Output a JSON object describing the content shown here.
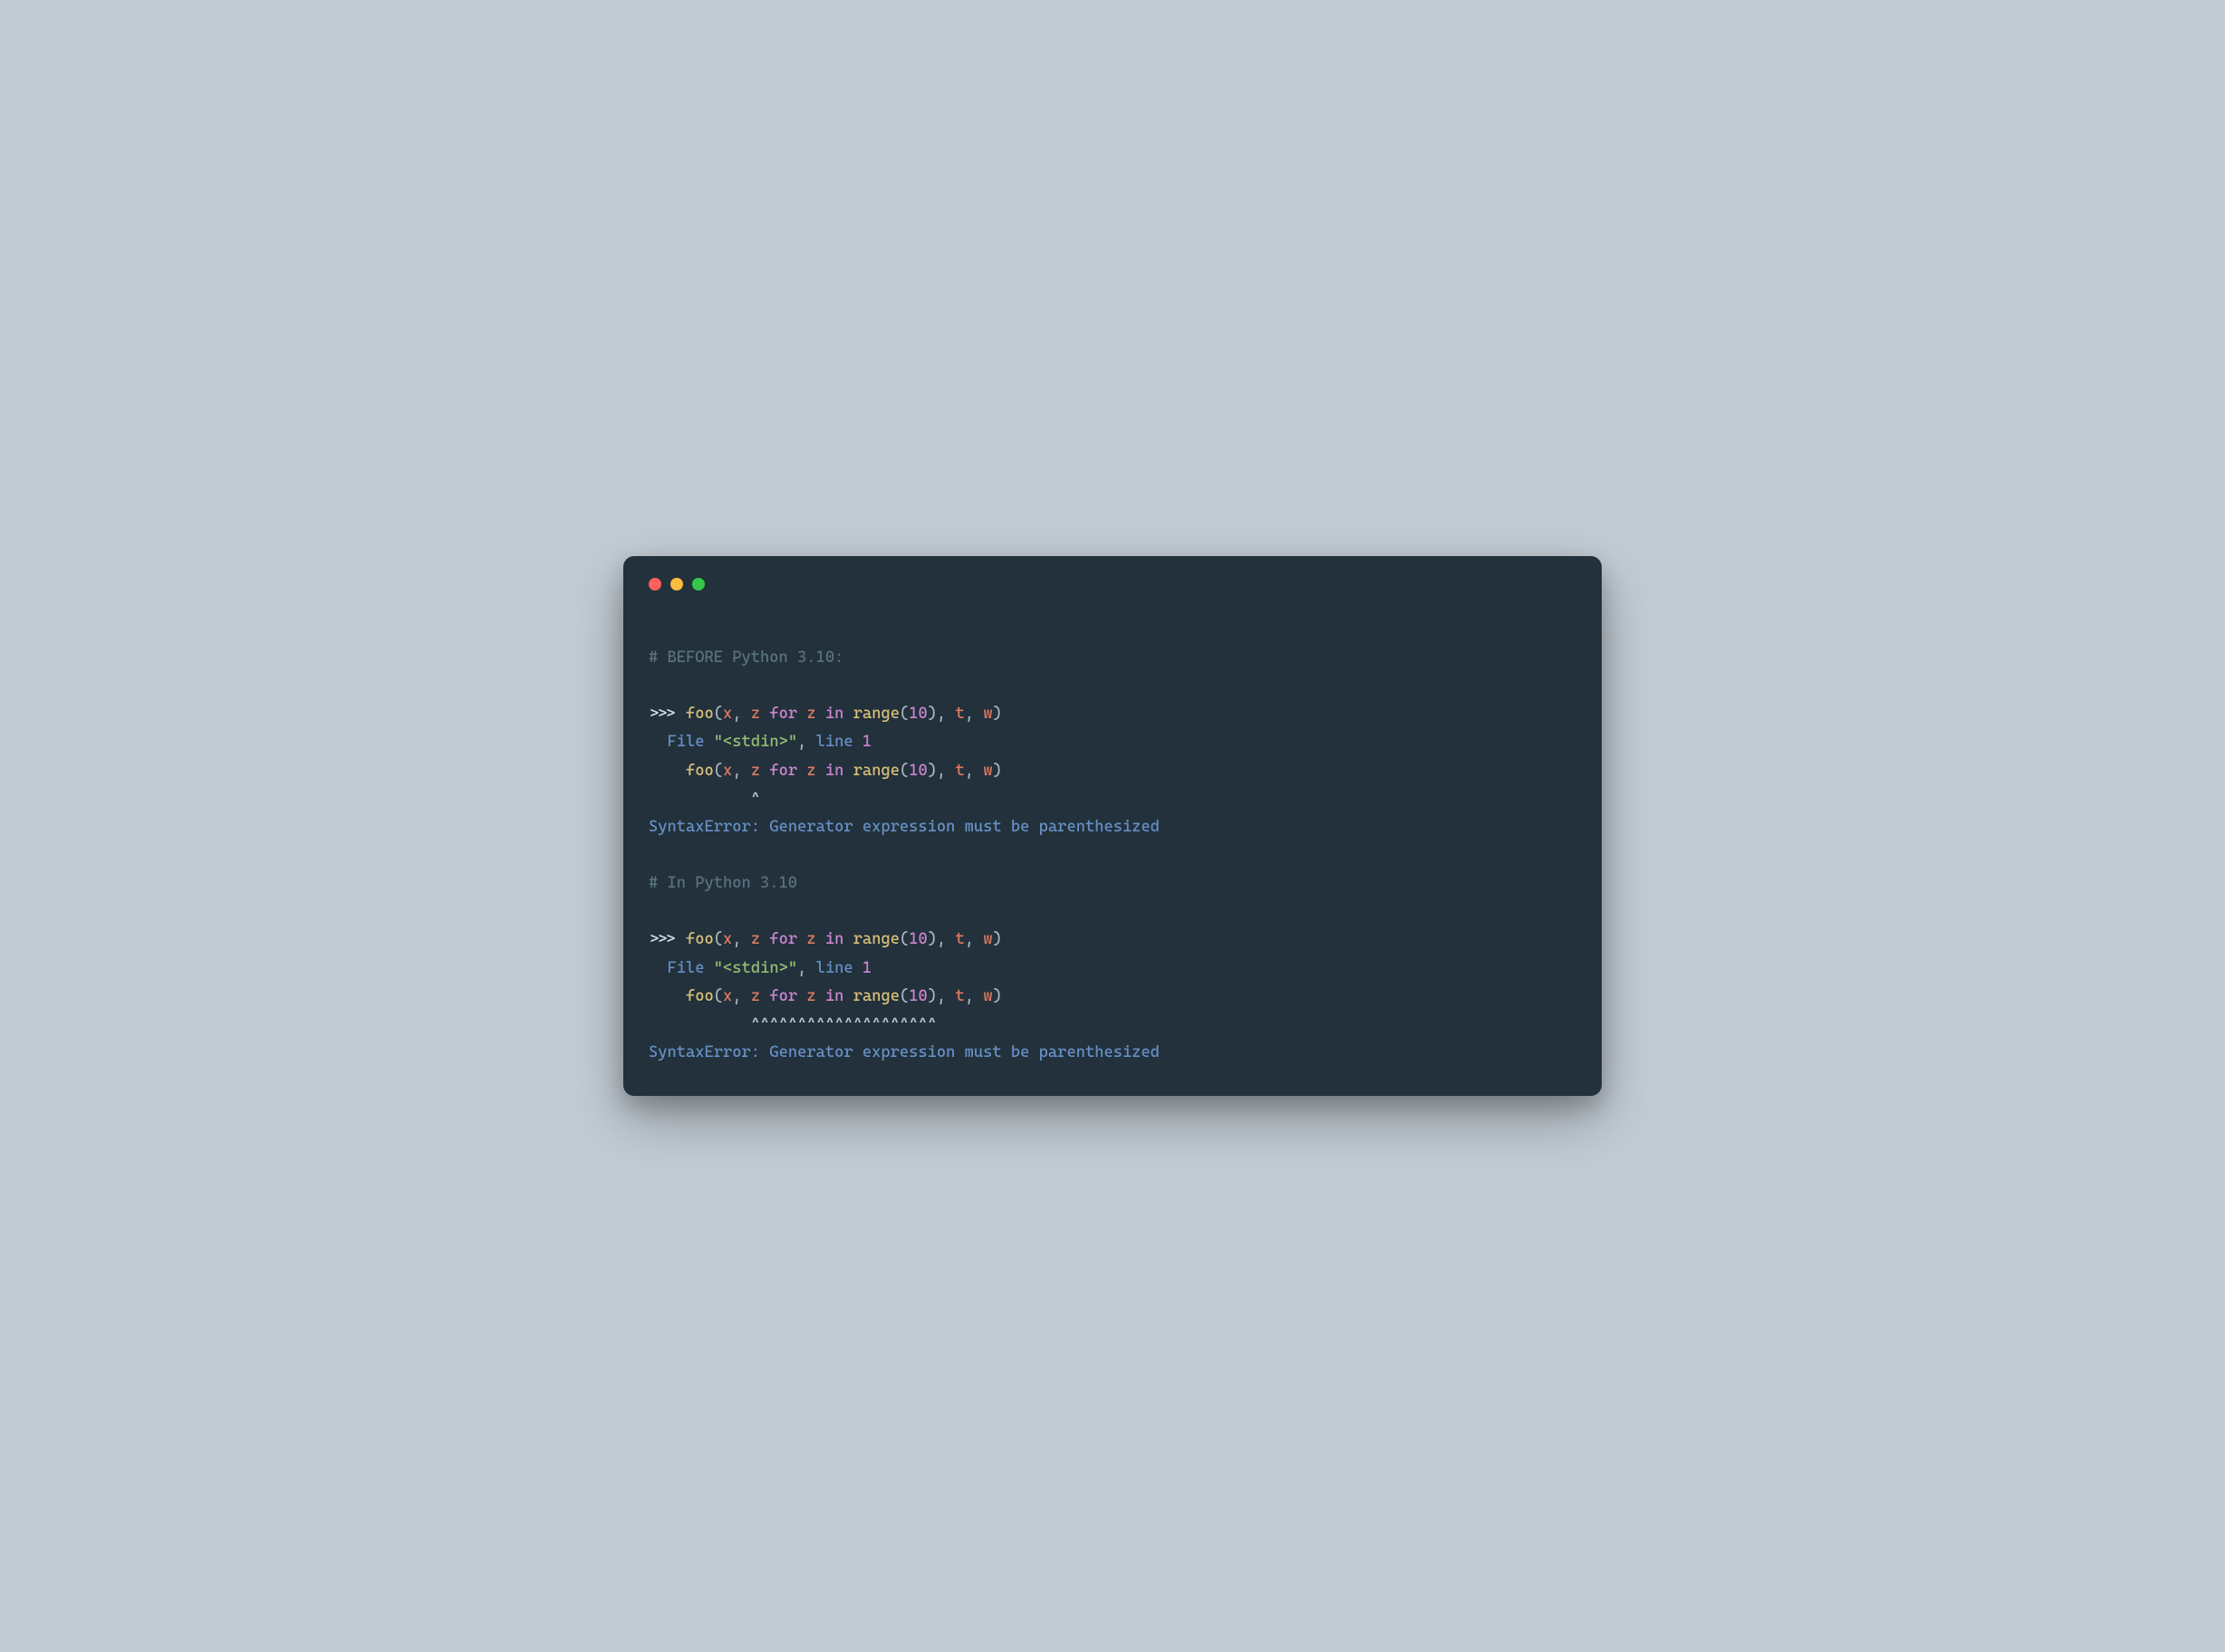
{
  "block1": {
    "comment": "# BEFORE Python 3.10:",
    "prompt": ">>> ",
    "call": {
      "func": "foo",
      "lp": "(",
      "arg1": "x",
      "comma1": ", ",
      "arg2a": "z",
      "sp1": " ",
      "kw_for": "for",
      "sp2": " ",
      "loopvar": "z",
      "sp3": " ",
      "kw_in": "in",
      "sp4": " ",
      "rangef": "range",
      "rlp": "(",
      "rnum": "10",
      "rrp": ")",
      "comma2": ", ",
      "arg3": "t",
      "comma3": ", ",
      "arg4": "w",
      "rp": ")"
    },
    "file_indent": "  ",
    "file_word": "File",
    "file_sp": " ",
    "file_str": "\"<stdin>\"",
    "file_comma": ", ",
    "line_word": "line",
    "line_sp": " ",
    "line_num": "1",
    "echo_indent": "    ",
    "caret_line": "           ^",
    "err_label": "SyntaxError",
    "err_colon": ": ",
    "err_msg": "Generator expression must be parenthesized"
  },
  "block2": {
    "comment": "# In Python 3.10",
    "prompt": ">>> ",
    "call": {
      "func": "foo",
      "lp": "(",
      "arg1": "x",
      "comma1": ", ",
      "arg2a": "z",
      "sp1": " ",
      "kw_for": "for",
      "sp2": " ",
      "loopvar": "z",
      "sp3": " ",
      "kw_in": "in",
      "sp4": " ",
      "rangef": "range",
      "rlp": "(",
      "rnum": "10",
      "rrp": ")",
      "comma2": ", ",
      "arg3": "t",
      "comma3": ", ",
      "arg4": "w",
      "rp": ")"
    },
    "file_indent": "  ",
    "file_word": "File",
    "file_sp": " ",
    "file_str": "\"<stdin>\"",
    "file_comma": ", ",
    "line_word": "line",
    "line_sp": " ",
    "line_num": "1",
    "echo_indent": "    ",
    "caret_line": "           ^^^^^^^^^^^^^^^^^^^^",
    "err_label": "SyntaxError",
    "err_colon": ": ",
    "err_msg": "Generator expression must be parenthesized"
  }
}
